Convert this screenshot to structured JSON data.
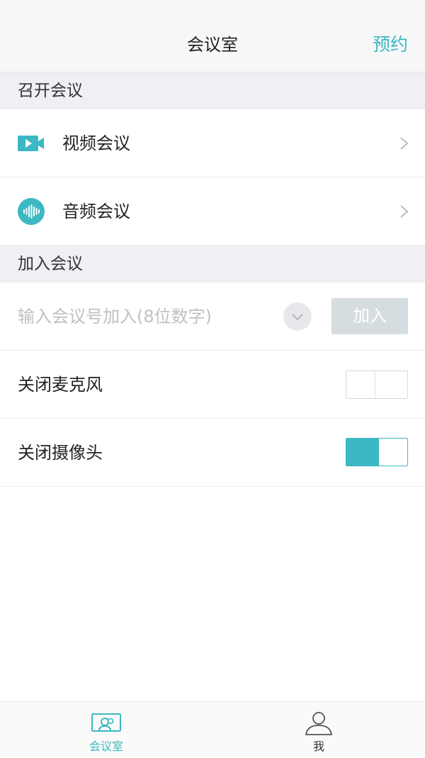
{
  "navbar": {
    "title": "会议室",
    "action": "预约"
  },
  "sections": {
    "start": "召开会议",
    "join": "加入会议"
  },
  "start_items": [
    {
      "label": "视频会议",
      "icon": "video-camera-icon"
    },
    {
      "label": "音频会议",
      "icon": "audio-wave-icon"
    }
  ],
  "join": {
    "placeholder": "输入会议号加入(8位数字)",
    "history_icon": "chevron-down-icon",
    "button": "加入"
  },
  "toggles": [
    {
      "label": "关闭麦克风",
      "state": "off"
    },
    {
      "label": "关闭摄像头",
      "state": "on"
    }
  ],
  "tabbar": [
    {
      "label": "会议室",
      "icon": "meeting-room-icon",
      "active": true
    },
    {
      "label": "我",
      "icon": "person-icon",
      "active": false
    }
  ],
  "colors": {
    "accent": "#3bb8c3",
    "join_button_disabled": "#d6dde1",
    "section_bg": "#efeff4"
  }
}
